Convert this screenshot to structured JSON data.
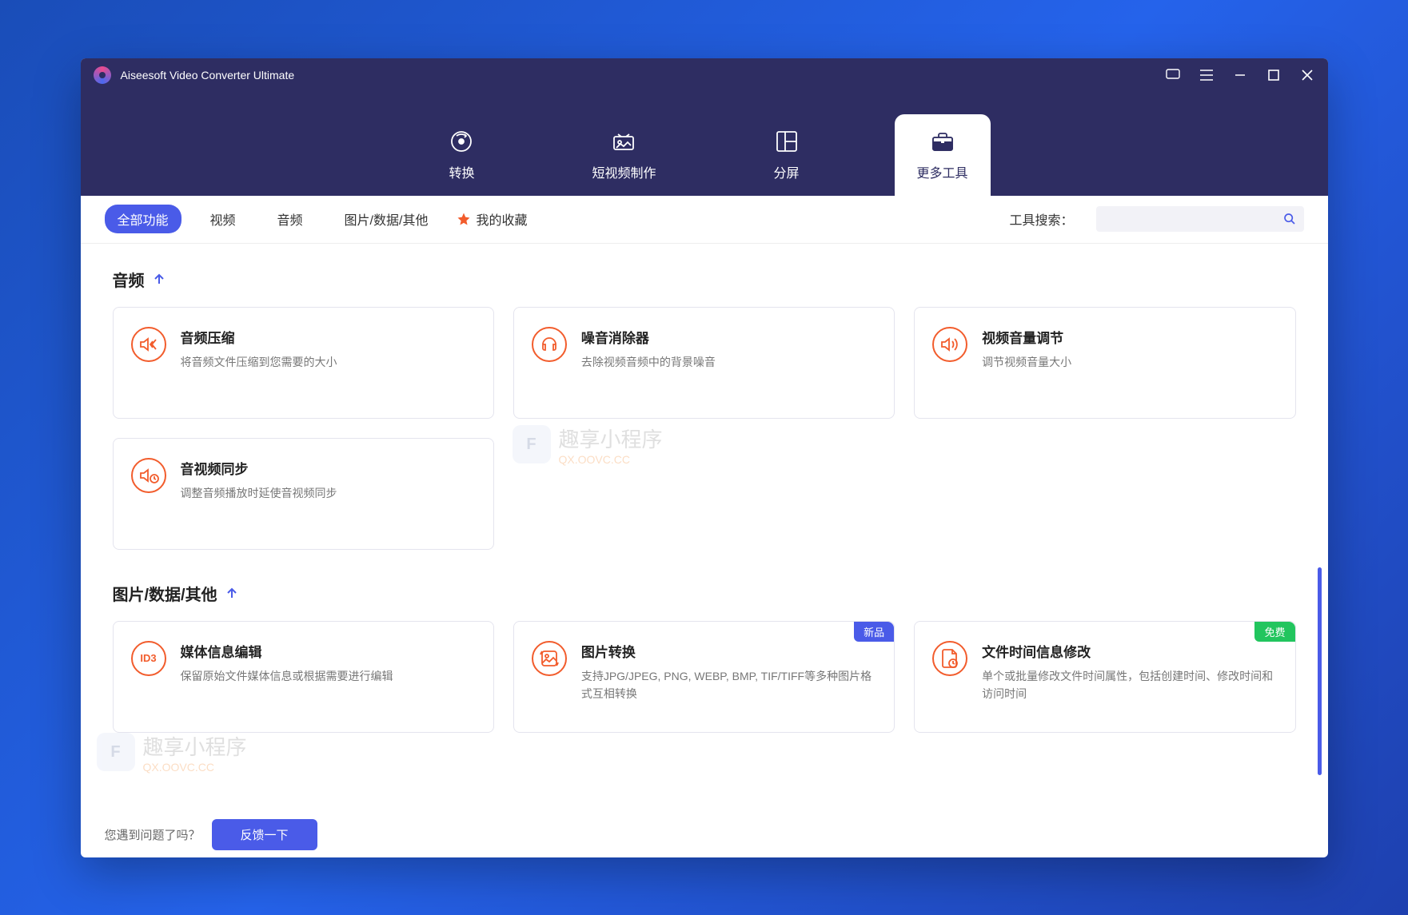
{
  "app": {
    "title": "Aiseesoft Video Converter Ultimate"
  },
  "nav": {
    "convert": "转换",
    "mv": "短视频制作",
    "collage": "分屏",
    "tools": "更多工具"
  },
  "filters": {
    "all": "全部功能",
    "video": "视频",
    "audio": "音频",
    "image": "图片/数据/其他",
    "favorites": "我的收藏"
  },
  "search": {
    "label": "工具搜索：",
    "placeholder": ""
  },
  "sections": {
    "audio": {
      "title": "音频",
      "cards": [
        {
          "title": "音频压缩",
          "desc": "将音频文件压缩到您需要的大小"
        },
        {
          "title": "噪音消除器",
          "desc": "去除视频音频中的背景噪音"
        },
        {
          "title": "视频音量调节",
          "desc": "调节视频音量大小"
        },
        {
          "title": "音视频同步",
          "desc": "调整音频播放时延使音视频同步"
        }
      ]
    },
    "image": {
      "title": "图片/数据/其他",
      "cards": [
        {
          "title": "媒体信息编辑",
          "desc": "保留原始文件媒体信息或根据需要进行编辑"
        },
        {
          "title": "图片转换",
          "desc": "支持JPG/JPEG, PNG, WEBP, BMP, TIF/TIFF等多种图片格式互相转换",
          "badge": "新品",
          "badgeType": "new"
        },
        {
          "title": "文件时间信息修改",
          "desc": "单个或批量修改文件时间属性，包括创建时间、修改时间和访问时间",
          "badge": "免费",
          "badgeType": "free"
        }
      ]
    }
  },
  "footer": {
    "question": "您遇到问题了吗？",
    "feedback": "反馈一下"
  },
  "watermark": {
    "text": "趣享小程序",
    "sub": "QX.OOVC.CC"
  }
}
